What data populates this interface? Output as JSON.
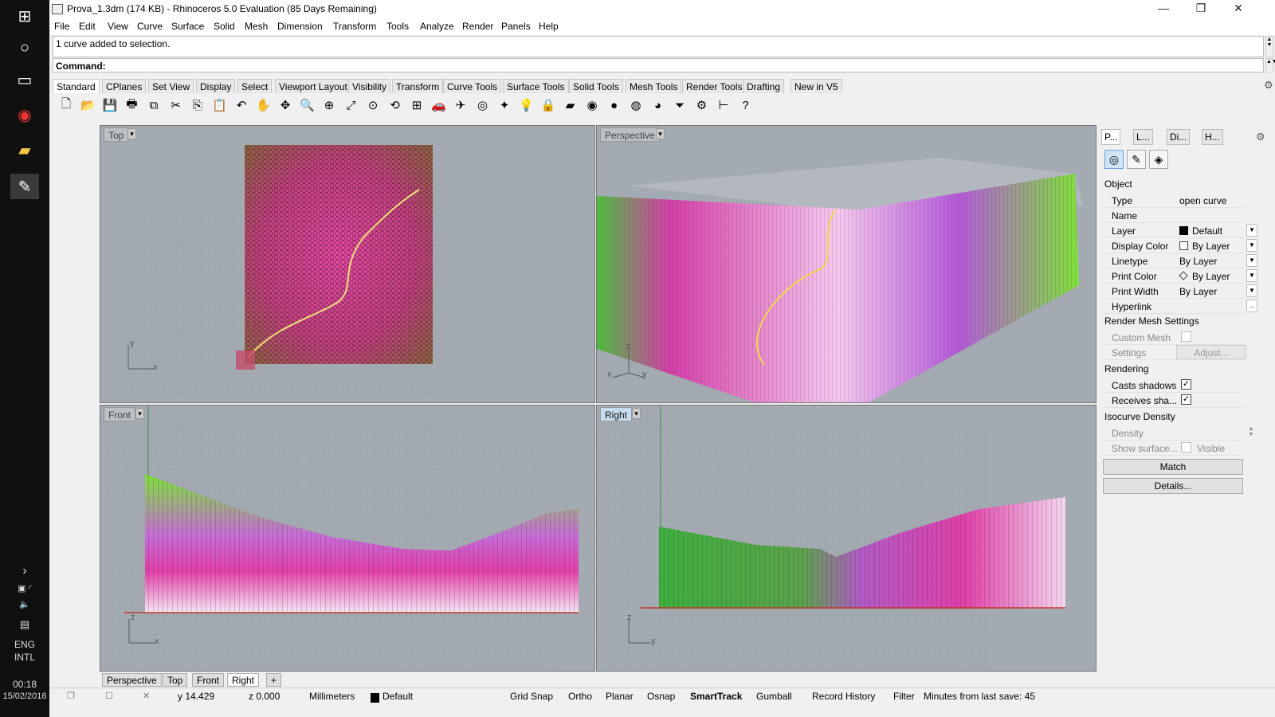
{
  "window": {
    "title": "Prova_1.3dm (174 KB) - Rhinoceros 5.0 Evaluation (85 Days Remaining)",
    "min_glyph": "—",
    "max_glyph": "❐",
    "close_glyph": "✕"
  },
  "menu": [
    "File",
    "Edit",
    "View",
    "Curve",
    "Surface",
    "Solid",
    "Mesh",
    "Dimension",
    "Transform",
    "Tools",
    "Analyze",
    "Render",
    "Panels",
    "Help"
  ],
  "command": {
    "history": "1 curve added to selection.",
    "prompt": "Command:"
  },
  "toolbar_tabs": [
    "Standard",
    "CPlanes",
    "Set View",
    "Display",
    "Select",
    "Viewport Layout",
    "Visibility",
    "Transform",
    "Curve Tools",
    "Surface Tools",
    "Solid Tools",
    "Mesh Tools",
    "Render Tools",
    "Drafting",
    "New in V5"
  ],
  "toolbar_icons": [
    "new-icon",
    "open-icon",
    "save-icon",
    "print-icon",
    "import-icon",
    "cut-icon",
    "copy-icon",
    "paste-icon",
    "undo-icon",
    "pan-icon",
    "move-view-icon",
    "zoom-icon",
    "zoom-window-icon",
    "zoom-extents-icon",
    "zoom-selected-icon",
    "rotate-view-icon",
    "viewport-layout-icon",
    "car-icon",
    "plane-icon",
    "cplane-icon",
    "snap-icon",
    "light-icon",
    "lock-icon",
    "layer-icon",
    "color-wheel-icon",
    "material-icon",
    "shaded-sphere-icon",
    "render-sphere-icon",
    "filter-icon",
    "gear-icon",
    "dimension-icon",
    "help-icon"
  ],
  "toolbar_glyphs": [
    "🗋",
    "📂",
    "💾",
    "🖶",
    "⧉",
    "✂",
    "⎘",
    "📋",
    "↶",
    "✋",
    "✥",
    "🔍",
    "⊕",
    "⤢",
    "⊙",
    "⟲",
    "⊞",
    "🚗",
    "✈",
    "◎",
    "✦",
    "💡",
    "🔒",
    "▰",
    "◉",
    "●",
    "◍",
    "◕",
    "⏷",
    "⚙",
    "⊢",
    "?"
  ],
  "taskbar": {
    "language": "ENG",
    "layout": "INTL",
    "time": "00:18",
    "date": "15/02/2016"
  },
  "viewports": {
    "top": {
      "label": "Top",
      "axis_x": "x",
      "axis_y": "y"
    },
    "perspective": {
      "label": "Perspective",
      "axis_x": "x",
      "axis_y": "y",
      "axis_z": "z"
    },
    "front": {
      "label": "Front",
      "axis_x": "x",
      "axis_z": "z"
    },
    "right": {
      "label": "Right",
      "axis_y": "y",
      "axis_z": "z"
    }
  },
  "viewport_tabs": [
    "Perspective",
    "Top",
    "Front",
    "Right"
  ],
  "viewport_tab_add": "+",
  "status": {
    "y": "y 14.429",
    "z": "z 0.000",
    "units": "Millimeters",
    "layer": "Default",
    "toggles": [
      "Grid Snap",
      "Ortho",
      "Planar",
      "Osnap",
      "SmartTrack",
      "Gumball",
      "Record History",
      "Filter"
    ],
    "last_save": "Minutes from last save: 45"
  },
  "panel": {
    "tabs": [
      "P...",
      "L...",
      "Di...",
      "H..."
    ],
    "section_object": "Object",
    "rows": [
      {
        "key": "Type",
        "value": "open curve"
      },
      {
        "key": "Name",
        "value": ""
      },
      {
        "key": "Layer",
        "value": "Default"
      },
      {
        "key": "Display Color",
        "value": "By Layer"
      },
      {
        "key": "Linetype",
        "value": "By Layer"
      },
      {
        "key": "Print Color",
        "value": "By Layer"
      },
      {
        "key": "Print Width",
        "value": "By Layer"
      },
      {
        "key": "Hyperlink",
        "value": ""
      }
    ],
    "section_render_mesh": "Render Mesh Settings",
    "custom_mesh": "Custom Mesh",
    "settings": "Settings",
    "adjust": "Adjust...",
    "section_rendering": "Rendering",
    "casts_shadows": "Casts shadows",
    "receives_shadows": "Receives sha...",
    "section_isocurve": "Isocurve Density",
    "density": "Density",
    "show_surface": "Show surface...",
    "visible": "Visible",
    "match": "Match",
    "details": "Details..."
  }
}
